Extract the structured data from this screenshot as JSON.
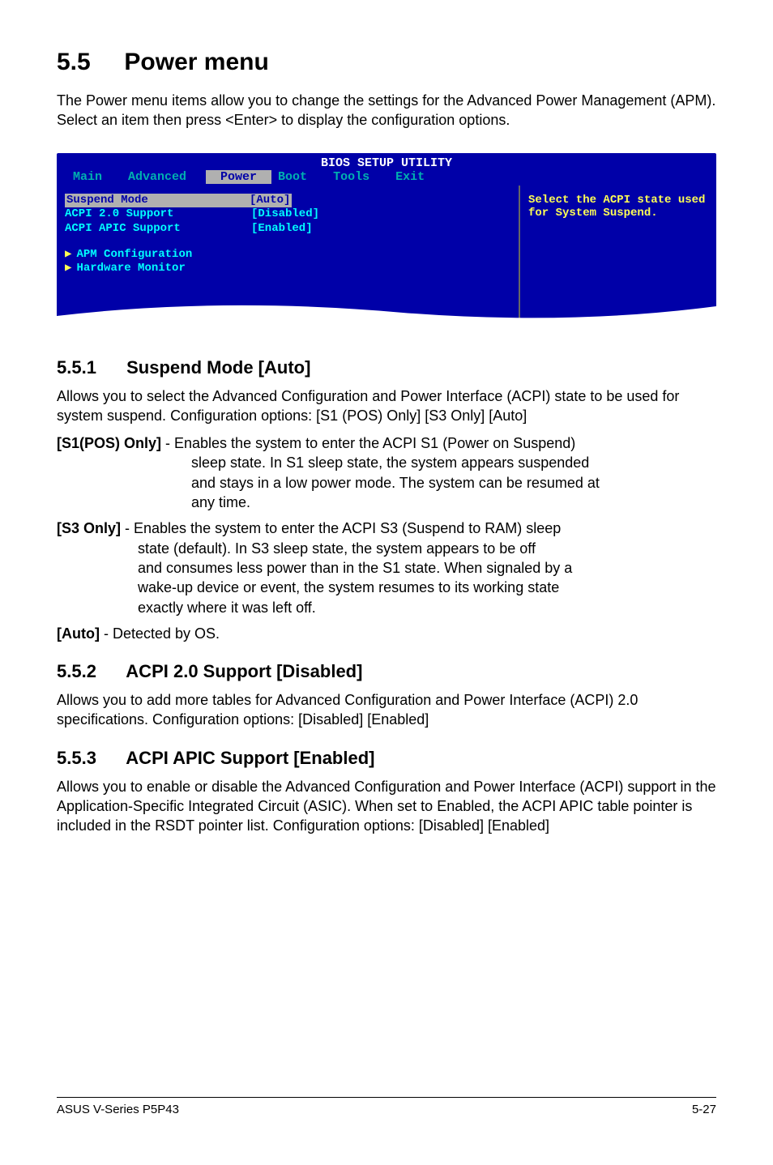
{
  "section": {
    "number": "5.5",
    "title": "Power menu"
  },
  "intro": "The Power menu items allow you to change the settings for the Advanced Power Management (APM). Select an item then press <Enter> to display the configuration options.",
  "bios": {
    "title": "BIOS SETUP UTILITY",
    "tabs": {
      "main": "Main",
      "advanced": "Advanced",
      "power": "Power",
      "boot": "Boot",
      "tools": "Tools",
      "exit": "Exit"
    },
    "rows": {
      "suspend_mode": {
        "label": "Suspend Mode",
        "value": "[Auto]"
      },
      "acpi20": {
        "label": "ACPI 2.0 Support",
        "value": "[Disabled]"
      },
      "acpiapic": {
        "label": "ACPI APIC Support",
        "value": "[Enabled]"
      }
    },
    "subitems": {
      "apm": "APM Configuration",
      "hw": "Hardware Monitor"
    },
    "help": "Select the ACPI state used for System Suspend."
  },
  "s551": {
    "heading_num": "5.5.1",
    "heading_text": "Suspend Mode [Auto]",
    "para": "Allows you to select the Advanced Configuration and Power Interface (ACPI) state to be used for system suspend. Configuration options: [S1 (POS) Only] [S3 Only] [Auto]",
    "opt1_label": "[S1(POS) Only]",
    "opt1_line1": " - Enables the system to enter the ACPI S1 (Power on Suspend)",
    "opt1_line2": "sleep state. In S1 sleep state, the system appears suspended",
    "opt1_line3": "and stays in a low power mode. The system can be resumed at",
    "opt1_line4": "any time.",
    "opt2_label": "[S3 Only]",
    "opt2_line1": " - Enables the system to enter the ACPI S3 (Suspend to RAM) sleep",
    "opt2_line2": "state (default). In S3 sleep state, the system appears to be off",
    "opt2_line3": "and consumes less power than in the S1 state. When signaled by a",
    "opt2_line4": "wake-up device or event, the system resumes to its working state",
    "opt2_line5": "exactly where it was left off.",
    "opt3_label": "[Auto]",
    "opt3_line1": " - Detected by OS."
  },
  "s552": {
    "heading_num": "5.5.2",
    "heading_text": "ACPI 2.0 Support [Disabled]",
    "para": "Allows you to add more tables for Advanced Configuration and Power Interface (ACPI) 2.0 specifications. Configuration options: [Disabled] [Enabled]"
  },
  "s553": {
    "heading_num": "5.5.3",
    "heading_text": "ACPI APIC Support [Enabled]",
    "para": "Allows you to enable or disable the Advanced Configuration and Power Interface (ACPI) support in the Application-Specific Integrated Circuit (ASIC). When set to Enabled, the ACPI APIC table pointer is included in the RSDT pointer list. Configuration options: [Disabled] [Enabled]"
  },
  "footer": {
    "left": "ASUS V-Series P5P43",
    "right": "5-27"
  }
}
